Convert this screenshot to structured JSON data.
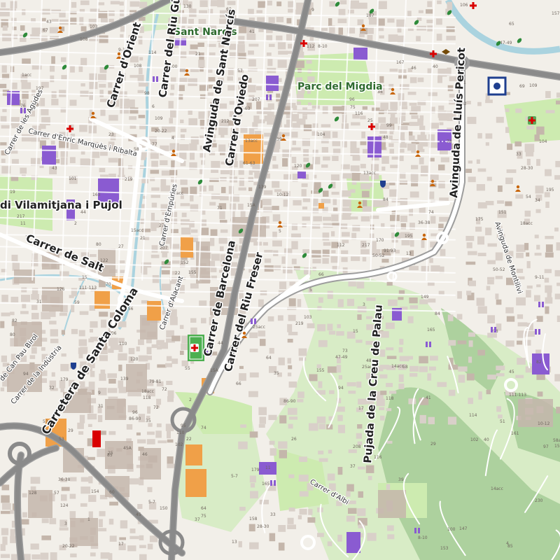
{
  "map": {
    "colors": {
      "background": "#f2efe9",
      "building": "#d9d0c9",
      "building_dark": "#c4b6ab",
      "park": "#cdebb0",
      "forest": "#add19e",
      "grass": "#d8ecc6",
      "water": "#aad3df",
      "highway": "#8a8a8a",
      "primary": "#ffffff",
      "school": "#f0a048",
      "place_of_worship": "#8a5bd1",
      "hospital": "#d90000",
      "pitch": "#4caf50"
    },
    "places": {
      "sant_narcis": "Sant Narcís",
      "parc_del_migdia": "Parc del Migdia"
    },
    "streets": {
      "carrer_riu_guell": "Carrer del Riu Güell",
      "carrer_orient": "Carrer d'Orient",
      "avinguda_sant_narcis": "Avinguda de Sant Narcís",
      "carrer_oviedo": "Carrer d'Oviedo",
      "avinguda_lluis_pericot": "Avinguda de Lluís Pericot",
      "vilamitjana": "di Vilamitjana i Pujol",
      "carrer_salt": "Carrer de Salt",
      "carrer_barcelona": "Carrer de Barcelona",
      "carrer_riu_freser": "Carrer del Riu Freser",
      "carretera_santa_coloma": "Carretera de Santa Coloma",
      "pujada_creu_palau": "Pujada de la Creu de Palau",
      "carrer_agudes": "Carrer de les Agudes",
      "carrer_enric_marques": "Carrer d'Enric Marquès i Ribalta",
      "carrer_empories": "Carrer d'Empúries",
      "carrer_alacant": "Carrer d'Alacant",
      "avinguda_montilivi": "Avinguda de Montilivi",
      "carrer_can_pau_birol": "de Can Pau Birol",
      "carrer_industria": "Carrer de la Indústria",
      "carrer_albi": "Carrer d'Albi"
    },
    "house_numbers": [
      "13acc",
      "21",
      "25",
      "33",
      "47-49",
      "75",
      "85",
      "103",
      "109",
      "111-113",
      "139",
      "155",
      "165",
      "179",
      "195",
      "207",
      "217",
      "219",
      "28-30",
      "20-22",
      "8-10",
      "6",
      "4",
      "2",
      "1",
      "3",
      "5",
      "9",
      "11",
      "13",
      "15",
      "17",
      "19",
      "23",
      "27",
      "29",
      "31",
      "35",
      "37",
      "39",
      "41",
      "43",
      "45",
      "51",
      "53",
      "55",
      "57",
      "61-63",
      "9-11",
      "15A",
      "25acc",
      "10-12",
      "5-7",
      "14acc",
      "18acc",
      "22",
      "26",
      "32",
      "34",
      "36-38",
      "40",
      "44",
      "46",
      "48",
      "50-52",
      "54",
      "58",
      "60",
      "64",
      "66",
      "70",
      "72",
      "74",
      "76",
      "78",
      "80",
      "82",
      "84",
      "86-90",
      "94",
      "96",
      "98",
      "100",
      "102",
      "104",
      "106",
      "108",
      "110",
      "112",
      "114",
      "116",
      "118",
      "120",
      "122",
      "124",
      "126",
      "128",
      "130",
      "150",
      "152",
      "154",
      "156",
      "158",
      "167",
      "170",
      "175",
      "187",
      "197",
      "208",
      "212",
      "230",
      "3acc",
      "1acc",
      "45A",
      "58acc",
      "15acc",
      "69",
      "71",
      "73",
      "77",
      "79-81",
      "59",
      "65",
      "67",
      "91-93",
      "95",
      "97",
      "99",
      "101",
      "147",
      "149",
      "151",
      "153",
      "157",
      "159",
      "161",
      "163"
    ]
  }
}
